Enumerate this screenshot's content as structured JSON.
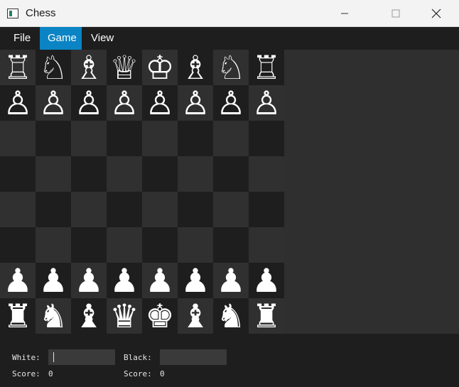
{
  "window": {
    "title": "Chess"
  },
  "menu": {
    "file": "File",
    "game": "Game",
    "view": "View"
  },
  "board": {
    "rows": [
      [
        "♖",
        "♘",
        "♗",
        "♕",
        "♔",
        "♗",
        "♘",
        "♖"
      ],
      [
        "♙",
        "♙",
        "♙",
        "♙",
        "♙",
        "♙",
        "♙",
        "♙"
      ],
      [
        "",
        "",
        "",
        "",
        "",
        "",
        "",
        ""
      ],
      [
        "",
        "",
        "",
        "",
        "",
        "",
        "",
        ""
      ],
      [
        "",
        "",
        "",
        "",
        "",
        "",
        "",
        ""
      ],
      [
        "",
        "",
        "",
        "",
        "",
        "",
        "",
        ""
      ],
      [
        "♟",
        "♟",
        "♟",
        "♟",
        "♟",
        "♟",
        "♟",
        "♟"
      ],
      [
        "♜",
        "♞",
        "♝",
        "♛",
        "♚",
        "♝",
        "♞",
        "♜"
      ]
    ]
  },
  "players": {
    "white_label": "White:",
    "black_label": "Black:",
    "white_value": "",
    "black_value": ""
  },
  "score": {
    "white_label": "Score:",
    "white_value": "0",
    "black_label": "Score:",
    "black_value": "0"
  }
}
